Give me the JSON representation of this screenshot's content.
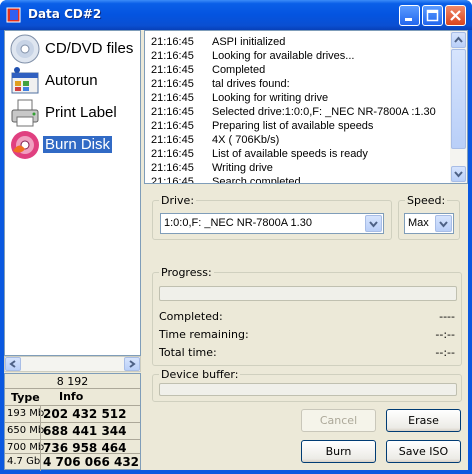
{
  "window": {
    "title": "Data CD#2"
  },
  "nav": [
    {
      "label": "CD/DVD files",
      "icon": "cd-icon",
      "selected": false
    },
    {
      "label": "Autorun",
      "icon": "autorun-icon",
      "selected": false
    },
    {
      "label": "Print Label",
      "icon": "printer-icon",
      "selected": false
    },
    {
      "label": "Burn Disk",
      "icon": "burn-disk-icon",
      "selected": true
    }
  ],
  "info": {
    "size_total": "8 192",
    "headers": {
      "type": "Type",
      "info": "Info"
    },
    "rows": [
      {
        "type": "193 Mb",
        "info": "202 432 512"
      },
      {
        "type": "650 Mb",
        "info": "688 441 344"
      },
      {
        "type": "700 Mb",
        "info": "736 958 464"
      },
      {
        "type": "4.7 Gb",
        "info": "4 706 066 432"
      }
    ]
  },
  "log": [
    {
      "time": "21:16:45",
      "msg": "ASPI initialized"
    },
    {
      "time": "21:16:45",
      "msg": "Looking for available drives..."
    },
    {
      "time": "21:16:45",
      "msg": "Completed"
    },
    {
      "time": "21:16:45",
      "msg": "tal drives found:"
    },
    {
      "time": "21:16:45",
      "msg": "Looking for writing drive"
    },
    {
      "time": "21:16:45",
      "msg": "Selected drive:1:0:0,F: _NEC    NR-7800A      :1.30"
    },
    {
      "time": "21:16:45",
      "msg": "Preparing list of available speeds"
    },
    {
      "time": "21:16:45",
      "msg": "    4X ( 706Kb/s)"
    },
    {
      "time": "21:16:45",
      "msg": "List of available speeds is ready"
    },
    {
      "time": "21:16:45",
      "msg": "Writing drive"
    },
    {
      "time": "21:16:45",
      "msg": "Search completed"
    }
  ],
  "drive": {
    "label": "Drive:",
    "value": "1:0:0,F: _NEC    NR-7800A        1.30"
  },
  "speed": {
    "label": "Speed:",
    "value": "Max"
  },
  "progress": {
    "label": "Progress:",
    "completed_label": "Completed:",
    "completed_value": "----",
    "remaining_label": "Time remaining:",
    "remaining_value": "--:--",
    "total_label": "Total time:",
    "total_value": "--:--"
  },
  "buffer": {
    "label": "Device buffer:"
  },
  "buttons": {
    "cancel": "Cancel",
    "erase": "Erase",
    "burn": "Burn",
    "save_iso": "Save ISO"
  }
}
